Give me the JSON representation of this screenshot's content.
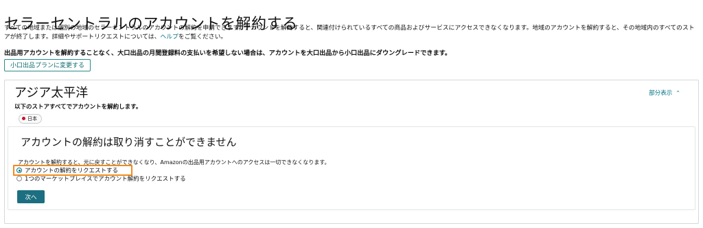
{
  "page": {
    "title": "セラーセントラルのアカウントを解約する"
  },
  "intro": {
    "text_before_link": "すべての地域または個別の地域のセラーセントラルのアカウントの解約を申請できます。アカウントを解約すると、関連付けられているすべての商品およびサービスにアクセスできなくなります。地域のアカウントを解約すると、その地域内のすべてのストアが終了します。詳細やサポートリクエストについては、",
    "help_link": "ヘルプ",
    "text_after_link": "をご覧ください。"
  },
  "downgrade": {
    "notice": "出品用アカウントを解約することなく、大口出品の月間登録料の支払いを希望しない場合は、アカウントを大口出品から小口出品にダウングレードできます。",
    "button_label": "小口出品プランに変更する"
  },
  "region": {
    "title": "アジア太平洋",
    "toggle_label": "部分表示",
    "toggle_icon": "chevron-up-icon",
    "subtitle": "以下のストアすべてでアカウントを解約します。",
    "stores": [
      {
        "label": "日本",
        "flag_color": "#c8102e"
      }
    ]
  },
  "warning": {
    "title": "アカウントの解約は取り消すことができません",
    "text": "アカウントを解約すると、元に戻すことができなくなり、Amazonの出品用アカウントへのアクセスは一切できなくなります。",
    "options": [
      {
        "label": "アカウントの解約をリクエストする",
        "selected": true
      },
      {
        "label": "1つのマーケットプレイスでアカウント解約をリクエストする",
        "selected": false
      }
    ],
    "next_button": "次へ"
  },
  "colors": {
    "accent": "#007185",
    "primary_button": "#1c6f80",
    "highlight": "#f08c1c"
  }
}
